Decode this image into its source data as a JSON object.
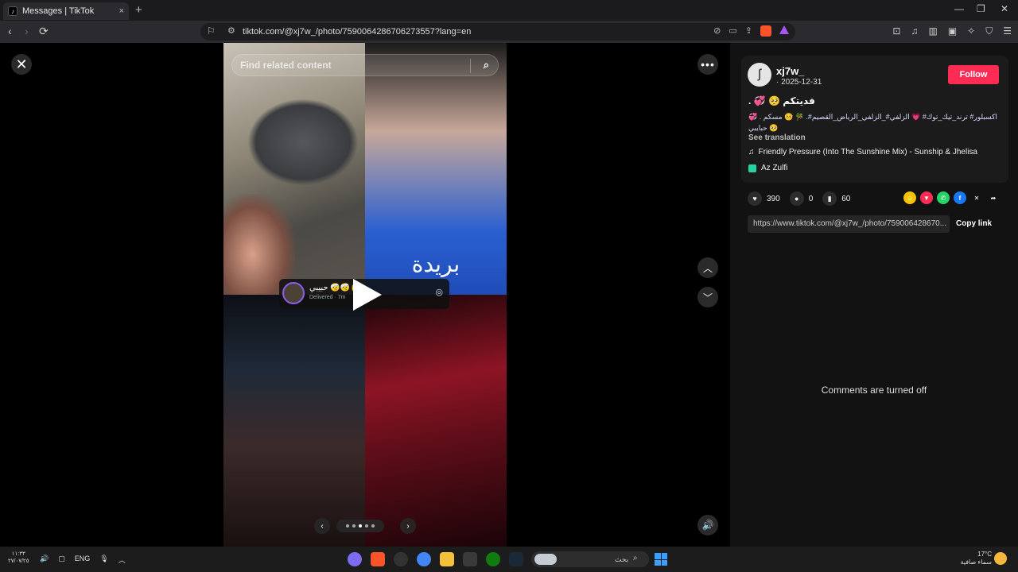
{
  "browser": {
    "tab_title": "Messages | TikTok",
    "tab_close": "×",
    "new_tab": "+",
    "url": "tiktok.com/@xj7w_/photo/7590064286706273557?lang=en"
  },
  "viewer": {
    "search_placeholder": "Find related content",
    "overlay_text": "بريدة",
    "message_preview": {
      "name": "حبيبي 🤕🤕✋ .",
      "status": "Delivered · 7m"
    },
    "slide_count": 5,
    "active_slide": 3
  },
  "post": {
    "author": "xj7w_",
    "date": "· 2025-12-31",
    "follow_label": "Follow",
    "caption_title": ". 💞 🥺 فديتكم",
    "caption_tags": "اكسبلور# ترند_تيك_توك# 💗 الزلفي#_الزلفي_الرياض_القصيم#. 🎋 🤒 مسكم . 💞 🥺 حبايبي",
    "see_translation": "See translation",
    "music": "Friendly Pressure (Into The Sunshine Mix) - Sunship & Jhelisa",
    "effect": "Az Zulfi",
    "likes": "390",
    "comments": "0",
    "saves": "60",
    "link": "https://www.tiktok.com/@xj7w_/photo/759006428670...",
    "copy_link": "Copy link",
    "comments_off": "Comments are turned off"
  },
  "taskbar": {
    "time": "١١:٣٣",
    "date": "٢٧/٠٧/٢٥",
    "lang": "ENG",
    "search_text": "بحث",
    "temperature": "17°C",
    "weather": "سماء صافية"
  },
  "colors": {
    "follow": "#fe2c55",
    "accent_blue": "#3aa0ff"
  }
}
